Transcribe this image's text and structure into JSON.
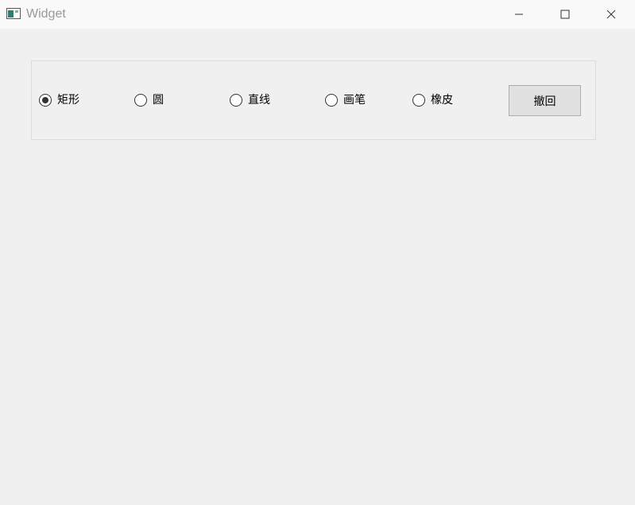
{
  "window": {
    "title": "Widget",
    "icon": "window-app-icon",
    "controls": [
      "minimize-icon",
      "maximize-icon",
      "close-icon"
    ]
  },
  "tools": {
    "options": [
      {
        "label": "矩形",
        "checked": true
      },
      {
        "label": "圆",
        "checked": false
      },
      {
        "label": "直线",
        "checked": false
      },
      {
        "label": "画笔",
        "checked": false
      },
      {
        "label": "橡皮",
        "checked": false
      }
    ],
    "undo_label": "撤回"
  }
}
